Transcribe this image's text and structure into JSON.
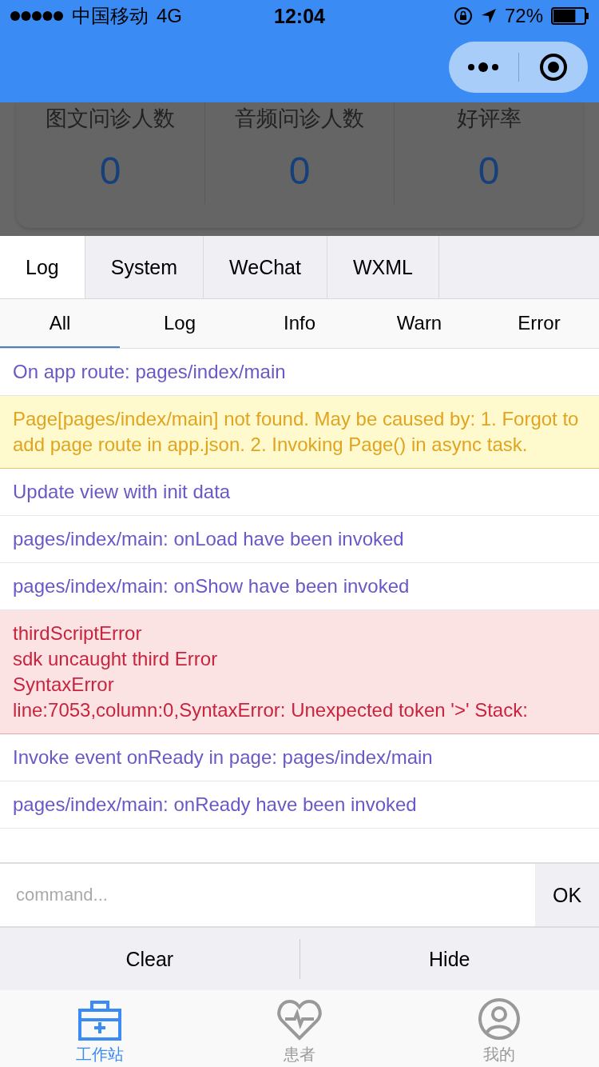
{
  "status_bar": {
    "carrier": "中国移动",
    "network": "4G",
    "time": "12:04",
    "battery": "72%"
  },
  "stats": [
    {
      "label": "图文问诊人数",
      "value": "0"
    },
    {
      "label": "音频问诊人数",
      "value": "0"
    },
    {
      "label": "好评率",
      "value": "0"
    }
  ],
  "console_tabs": [
    {
      "label": "Log",
      "selected": true
    },
    {
      "label": "System",
      "selected": false
    },
    {
      "label": "WeChat",
      "selected": false
    },
    {
      "label": "WXML",
      "selected": false
    }
  ],
  "filters": [
    {
      "label": "All",
      "selected": true
    },
    {
      "label": "Log",
      "selected": false
    },
    {
      "label": "Info",
      "selected": false
    },
    {
      "label": "Warn",
      "selected": false
    },
    {
      "label": "Error",
      "selected": false
    }
  ],
  "logs": [
    {
      "kind": "log",
      "lines": [
        "On app route: pages/index/main"
      ]
    },
    {
      "kind": "warn",
      "lines": [
        "Page[pages/index/main] not found. May be caused by: 1. Forgot to add page route in app.json. 2. Invoking Page() in async task."
      ]
    },
    {
      "kind": "log",
      "lines": [
        "Update view with init data"
      ]
    },
    {
      "kind": "log",
      "lines": [
        "pages/index/main: onLoad have been invoked"
      ]
    },
    {
      "kind": "log",
      "lines": [
        "pages/index/main: onShow have been invoked"
      ]
    },
    {
      "kind": "error",
      "lines": [
        "thirdScriptError",
        "sdk uncaught third Error",
        "SyntaxError",
        "line:7053,column:0,SyntaxError: Unexpected token '>' Stack:"
      ]
    },
    {
      "kind": "log",
      "lines": [
        "Invoke event onReady in page: pages/index/main"
      ]
    },
    {
      "kind": "log",
      "lines": [
        "pages/index/main: onReady have been invoked"
      ]
    }
  ],
  "command": {
    "placeholder": "command...",
    "submit": "OK"
  },
  "actions": [
    "Clear",
    "Hide"
  ],
  "tab_bar": [
    {
      "label": "工作站",
      "selected": true
    },
    {
      "label": "患者",
      "selected": false
    },
    {
      "label": "我的",
      "selected": false
    }
  ]
}
